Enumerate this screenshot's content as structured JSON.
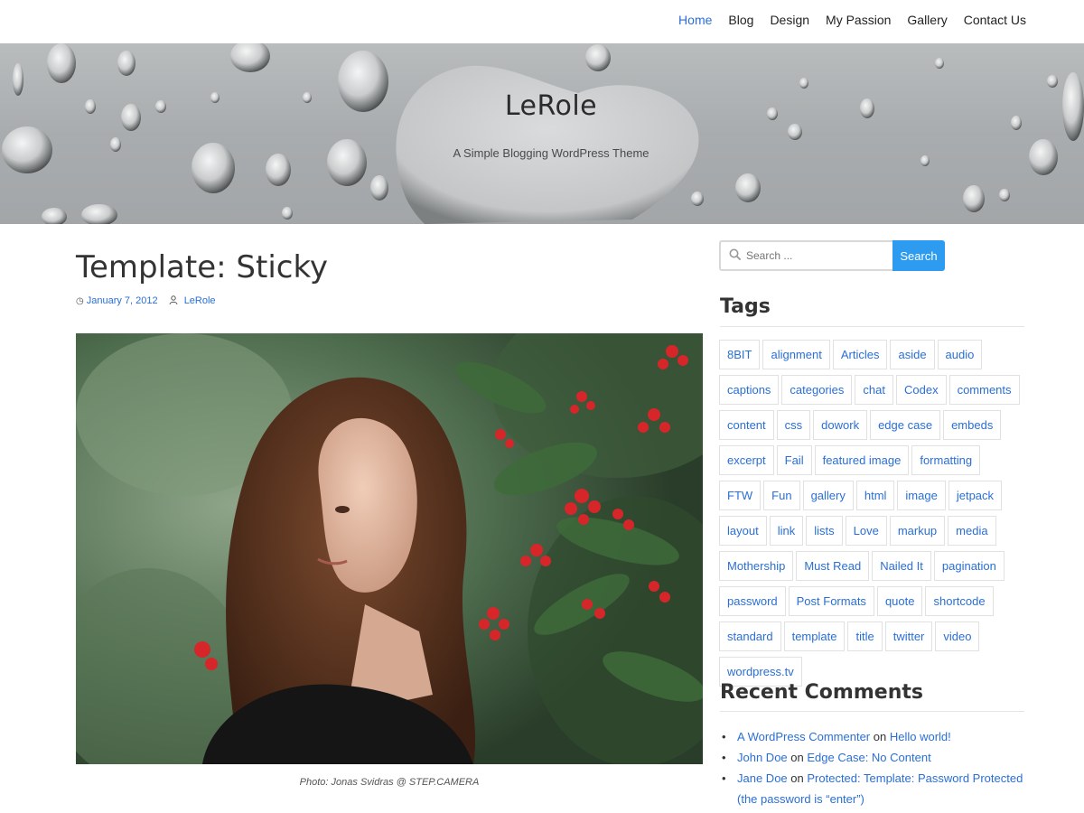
{
  "nav": {
    "items": [
      {
        "label": "Home",
        "active": true
      },
      {
        "label": "Blog",
        "active": false
      },
      {
        "label": "Design",
        "active": false
      },
      {
        "label": "My Passion",
        "active": false
      },
      {
        "label": "Gallery",
        "active": false
      },
      {
        "label": "Contact Us",
        "active": false
      }
    ]
  },
  "header": {
    "site_title": "LeRole",
    "tagline": "A Simple Blogging WordPress Theme"
  },
  "post": {
    "title": "Template: Sticky",
    "date": "January 7, 2012",
    "author": "LeRole",
    "image_caption": "Photo: Jonas Svidras @ STEP.CAMERA"
  },
  "sidebar": {
    "search": {
      "placeholder": "Search ...",
      "button": "Search"
    },
    "tags_title": "Tags",
    "tags": [
      "8BIT",
      "alignment",
      "Articles",
      "aside",
      "audio",
      "captions",
      "categories",
      "chat",
      "Codex",
      "comments",
      "content",
      "css",
      "dowork",
      "edge case",
      "embeds",
      "excerpt",
      "Fail",
      "featured image",
      "formatting",
      "FTW",
      "Fun",
      "gallery",
      "html",
      "image",
      "jetpack",
      "layout",
      "link",
      "lists",
      "Love",
      "markup",
      "media",
      "Mothership",
      "Must Read",
      "Nailed It",
      "pagination",
      "password",
      "Post Formats",
      "quote",
      "shortcode",
      "standard",
      "template",
      "title",
      "twitter",
      "video",
      "wordpress.tv"
    ],
    "recent_comments_title": "Recent Comments",
    "recent_comments": [
      {
        "author": "A WordPress Commenter",
        "on": "on",
        "post": "Hello world!"
      },
      {
        "author": "John Doe",
        "on": "on",
        "post": "Edge Case: No Content"
      },
      {
        "author": "Jane Doe",
        "on": "on",
        "post": "Protected: Template: Password Protected (the password is “enter”)"
      }
    ]
  },
  "colors": {
    "link": "#2a6fd6",
    "search_button": "#2d9bef",
    "text": "#333333"
  }
}
